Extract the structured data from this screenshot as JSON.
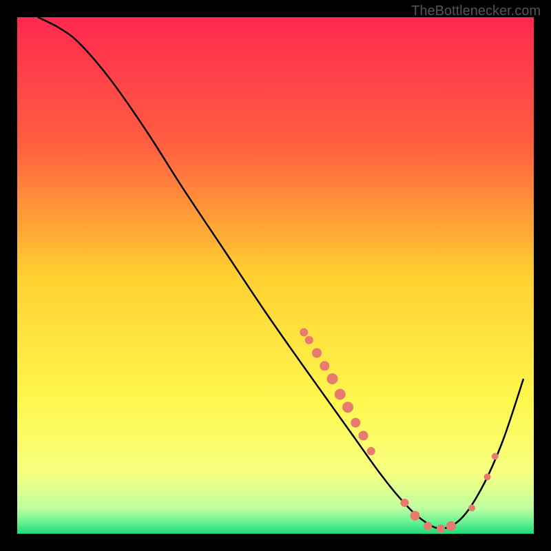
{
  "watermark": "TheBottlenecker.com",
  "chart_data": {
    "type": "line",
    "title": "",
    "xlabel": "",
    "ylabel": "",
    "xlim": [
      0,
      100
    ],
    "ylim": [
      0,
      100
    ],
    "background_gradient": {
      "stops": [
        {
          "offset": 0,
          "color": "#ff2850"
        },
        {
          "offset": 0.25,
          "color": "#ff6040"
        },
        {
          "offset": 0.5,
          "color": "#ffd030"
        },
        {
          "offset": 0.75,
          "color": "#fff850"
        },
        {
          "offset": 0.88,
          "color": "#f8ff80"
        },
        {
          "offset": 0.95,
          "color": "#c0ffa0"
        },
        {
          "offset": 0.98,
          "color": "#60f090"
        },
        {
          "offset": 1.0,
          "color": "#20d878"
        }
      ]
    },
    "series": [
      {
        "name": "bottleneck-curve",
        "x": [
          4,
          8,
          12,
          18,
          25,
          32,
          40,
          48,
          55,
          60,
          65,
          70,
          74,
          78,
          82,
          86,
          90,
          94,
          98
        ],
        "y": [
          100,
          98,
          95,
          88,
          78,
          67,
          55,
          43,
          33,
          26,
          19,
          12,
          7,
          3,
          1,
          3,
          9,
          18,
          30
        ]
      }
    ],
    "markers": {
      "name": "highlighted-points",
      "color": "#e87a70",
      "points": [
        {
          "x": 55.5,
          "y": 39,
          "r": 6
        },
        {
          "x": 56.5,
          "y": 37.5,
          "r": 6
        },
        {
          "x": 58,
          "y": 35,
          "r": 7
        },
        {
          "x": 59.5,
          "y": 32.5,
          "r": 7
        },
        {
          "x": 61,
          "y": 30,
          "r": 8
        },
        {
          "x": 62.5,
          "y": 27,
          "r": 8
        },
        {
          "x": 64,
          "y": 24.5,
          "r": 8
        },
        {
          "x": 65.5,
          "y": 21.5,
          "r": 7
        },
        {
          "x": 67,
          "y": 19,
          "r": 7
        },
        {
          "x": 68.5,
          "y": 16,
          "r": 6
        },
        {
          "x": 75,
          "y": 6,
          "r": 6
        },
        {
          "x": 77,
          "y": 3.5,
          "r": 7
        },
        {
          "x": 79.5,
          "y": 1.5,
          "r": 6
        },
        {
          "x": 82,
          "y": 1,
          "r": 6
        },
        {
          "x": 84,
          "y": 1.5,
          "r": 7
        },
        {
          "x": 88,
          "y": 5,
          "r": 5
        },
        {
          "x": 91,
          "y": 11,
          "r": 5
        },
        {
          "x": 92.5,
          "y": 15,
          "r": 5
        }
      ]
    }
  }
}
